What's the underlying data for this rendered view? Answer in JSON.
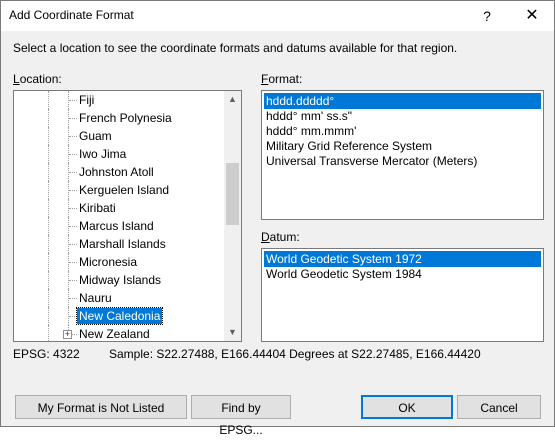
{
  "window": {
    "title": "Add Coordinate Format",
    "help_glyph": "?",
    "close_glyph": "✕"
  },
  "instructions": "Select a location to see the coordinate formats and datums available for that region.",
  "location": {
    "label_accel": "L",
    "label_rest": "ocation:",
    "items": [
      {
        "label": "Fiji"
      },
      {
        "label": "French Polynesia"
      },
      {
        "label": "Guam"
      },
      {
        "label": "Iwo Jima"
      },
      {
        "label": "Johnston Atoll"
      },
      {
        "label": "Kerguelen Island"
      },
      {
        "label": "Kiribati"
      },
      {
        "label": "Marcus Island"
      },
      {
        "label": "Marshall Islands"
      },
      {
        "label": "Micronesia"
      },
      {
        "label": "Midway Islands"
      },
      {
        "label": "Nauru"
      },
      {
        "label": "New Caledonia",
        "selected": true
      },
      {
        "label": "New Zealand",
        "expandable": true
      }
    ],
    "scroll_up_glyph": "▲",
    "scroll_down_glyph": "▼",
    "expander_glyph": "+"
  },
  "format": {
    "label_accel": "F",
    "label_rest": "ormat:",
    "items": [
      {
        "label": "hddd.ddddd°",
        "selected": true
      },
      {
        "label": "hddd° mm' ss.s\""
      },
      {
        "label": "hddd° mm.mmm'"
      },
      {
        "label": "Military Grid Reference System"
      },
      {
        "label": "Universal Transverse Mercator (Meters)"
      }
    ]
  },
  "datum": {
    "label_accel": "D",
    "label_rest": "atum:",
    "items": [
      {
        "label": "World Geodetic System 1972",
        "selected": true
      },
      {
        "label": "World Geodetic System 1984"
      }
    ]
  },
  "status": {
    "epsg": "EPSG: 4322",
    "sample": "Sample: S22.27488, E166.44404 Degrees at S22.27485, E166.44420"
  },
  "buttons": {
    "not_listed": "My Format is Not Listed",
    "find_epsg": "Find by EPSG...",
    "ok": "OK",
    "cancel": "Cancel"
  },
  "colors": {
    "selection": "#0078d7",
    "dialog_bg": "#f0f0f0"
  }
}
